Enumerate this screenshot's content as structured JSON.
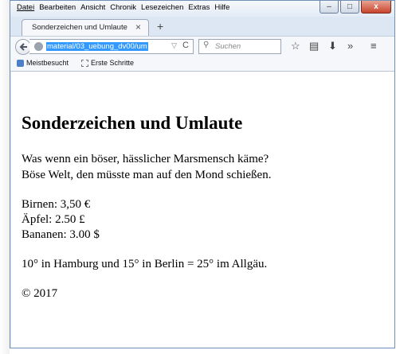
{
  "menu": [
    "Datei",
    "Bearbeiten",
    "Ansicht",
    "Chronik",
    "Lesezeichen",
    "Extras",
    "Hilfe"
  ],
  "window_controls": {
    "minimize": "–",
    "maximize": "□",
    "close": "x"
  },
  "tab": {
    "title": "Sonderzeichen und Umlaute",
    "close": "×",
    "new": "+"
  },
  "navbar": {
    "url": "material/03_uebung_dv00/um",
    "search_placeholder": "Suchen",
    "icons": [
      "back-arrow",
      "globe",
      "dropdown",
      "reload",
      "search",
      "star",
      "reading-list",
      "download",
      "overflow",
      "hamburger-menu"
    ]
  },
  "bookmarks": [
    "Meistbesucht",
    "Erste Schritte"
  ],
  "page": {
    "heading": "Sonderzeichen und Umlaute",
    "para1_line1": "Was wenn ein böser, hässlicher Marsmensch käme?",
    "para1_line2": "Böse Welt, den müsste man auf den Mond schießen.",
    "price1": "Birnen: 3,50 €",
    "price2": "Äpfel: 2.50 £",
    "price3": "Bananen: 3.00 $",
    "temps": "10° in Hamburg und 15° in Berlin = 25° im Allgäu.",
    "copyright": "© 2017"
  }
}
